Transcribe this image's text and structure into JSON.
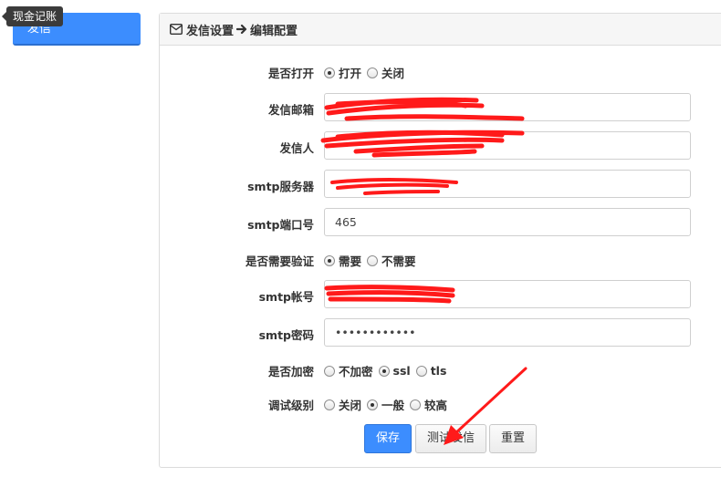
{
  "sidebar": {
    "active_item": "发信",
    "tooltip": "现金记账"
  },
  "panel": {
    "title_part1": "发信设置",
    "title_part2": "编辑配置"
  },
  "form": {
    "enable": {
      "label": "是否打开",
      "options": [
        "打开",
        "关闭"
      ],
      "selected": "打开"
    },
    "sender_email": {
      "label": "发信邮箱",
      "value": "",
      "redacted": true
    },
    "sender_name": {
      "label": "发信人",
      "value": "",
      "redacted": true
    },
    "smtp_server": {
      "label": "smtp服务器",
      "value": "",
      "redacted": true
    },
    "smtp_port": {
      "label": "smtp端口号",
      "value": "465"
    },
    "auth": {
      "label": "是否需要验证",
      "options": [
        "需要",
        "不需要"
      ],
      "selected": "需要"
    },
    "smtp_account": {
      "label": "smtp帐号",
      "value": "",
      "redacted": true
    },
    "smtp_password": {
      "label": "smtp密码",
      "value": "••••••••••••"
    },
    "encryption": {
      "label": "是否加密",
      "options": [
        "不加密",
        "ssl",
        "tls"
      ],
      "selected": "ssl"
    },
    "debug": {
      "label": "调试级别",
      "options": [
        "关闭",
        "一般",
        "较高"
      ],
      "selected": "一般"
    }
  },
  "buttons": {
    "save": "保存",
    "test": "测试发信",
    "reset": "重置"
  },
  "colors": {
    "primary": "#3c8dfe",
    "annotation": "#ff0000"
  }
}
